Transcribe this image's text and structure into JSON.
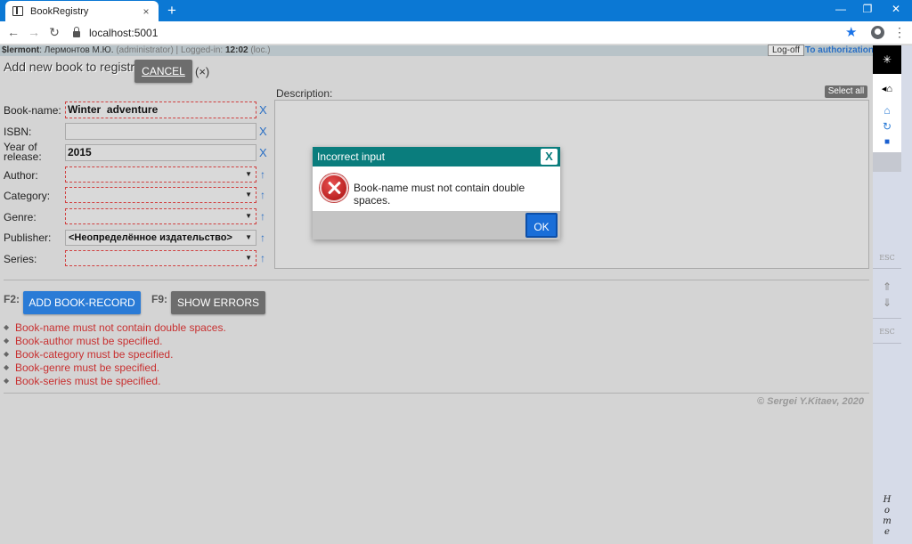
{
  "browser": {
    "tab_title": "BookRegistry",
    "tab_close": "×",
    "new_tab": "+",
    "url": "localhost:5001",
    "win_minimize": "—",
    "win_restore": "❐",
    "win_close": "✕"
  },
  "status": {
    "user": "$lermont",
    "user_name": ": Лермонтов М.Ю.",
    "role": " (administrator) | Logged-in: ",
    "login_time": "12:02",
    "loc": " (loc.)",
    "logoff": "Log-off",
    "to_authorization": "To authorization"
  },
  "page": {
    "title": "Add new book to registry",
    "cancel": "CANCEL",
    "cancel_shortcut": "(×)"
  },
  "form": {
    "book_name_label": "Book-name:",
    "book_name_value": "Winter  adventure",
    "isbn_label": "ISBN:",
    "isbn_value": "",
    "year_label": "Year of release:",
    "year_value": "2015",
    "author_label": "Author:",
    "author_value": "",
    "category_label": "Category:",
    "category_value": "",
    "genre_label": "Genre:",
    "genre_value": "",
    "publisher_label": "Publisher:",
    "publisher_value": "<Неопределённое издательство>",
    "series_label": "Series:",
    "series_value": "",
    "clear_symbol": "X",
    "up_symbol": "↑",
    "dropdown_symbol": "▼",
    "description_label": "Description:",
    "select_all": "Select all"
  },
  "actions": {
    "f2": "F2:",
    "add_record": "ADD BOOK-RECORD",
    "f9": "F9:",
    "show_errors": "SHOW ERRORS"
  },
  "errors": [
    "Book-name must not contain double spaces.",
    "Book-author must be specified.",
    "Book-category must be specified.",
    "Book-genre must be specified.",
    "Book-series must be specified."
  ],
  "footer": {
    "copyright": "© Sergei Y.Kitaev, 2020"
  },
  "modal": {
    "title": "Incorrect input",
    "close": "X",
    "message": "Book-name must not contain double spaces.",
    "ok": "OK"
  },
  "sidebar": {
    "top_symbol": "✳",
    "esc1": "ESC",
    "esc2": "ESC",
    "home_label": "H o m e",
    "up_arrow": "⇑",
    "down_arrow": "⇓"
  },
  "colors": {
    "accent_blue": "#2a7bd6",
    "dialog_header": "#0a7d7d",
    "error_red": "#c83030",
    "browser_chrome": "#0b78d4"
  }
}
